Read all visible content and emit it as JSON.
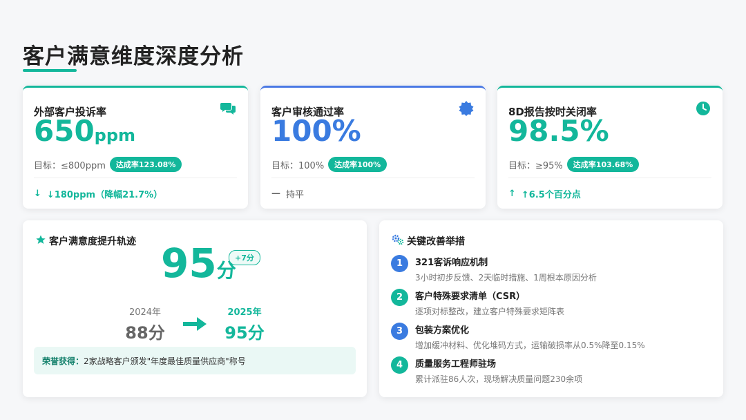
{
  "page": {
    "title": "客户满意维度深度分析"
  },
  "kpis": [
    {
      "title": "外部客户投诉率",
      "value": "650",
      "unit": "ppm",
      "target": "目标：≤800ppm",
      "badge": "达成率123.08%",
      "trend_icon": "↓",
      "trend": "↓180ppm（降幅21.7%）",
      "icon": "chat-bubbles-icon"
    },
    {
      "title": "客户审核通过率",
      "value": "100%",
      "unit": "",
      "target": "目标：100%",
      "badge": "达成率100%",
      "trend_icon": "—",
      "trend": "持平",
      "icon": "award-badge-icon"
    },
    {
      "title": "8D报告按时关闭率",
      "value": "98.5%",
      "unit": "",
      "target": "目标：≥95%",
      "badge": "达成率103.68%",
      "trend_icon": "↑",
      "trend": "↑6.5个百分点",
      "icon": "clock-icon"
    }
  ],
  "satisfaction": {
    "title": "客户满意度提升轨迹",
    "score": "95",
    "score_unit": "分",
    "delta": "+7分",
    "prev_year": "2024年",
    "prev_score": "88分",
    "curr_year": "2025年",
    "curr_score": "95分",
    "honor_label": "荣誉获得：",
    "honor_text": "2家战略客户颁发\"年度最佳质量供应商\"称号"
  },
  "measures": {
    "title": "关键改善举措",
    "items": [
      {
        "num": "1",
        "title": "321客诉响应机制",
        "desc": "3小时初步反馈、2天临时措施、1周根本原因分析"
      },
      {
        "num": "2",
        "title": "客户特殊要求清单（CSR）",
        "desc": "逐项对标整改，建立客户特殊要求矩阵表"
      },
      {
        "num": "3",
        "title": "包装方案优化",
        "desc": "增加缓冲材料、优化堆码方式，运输破损率从0.5%降至0.15%"
      },
      {
        "num": "4",
        "title": "质量服务工程师驻场",
        "desc": "累计派驻86人次，现场解决质量问题230余项"
      }
    ]
  },
  "colors": {
    "green": "#13b79b",
    "blue": "#3a7be0"
  }
}
